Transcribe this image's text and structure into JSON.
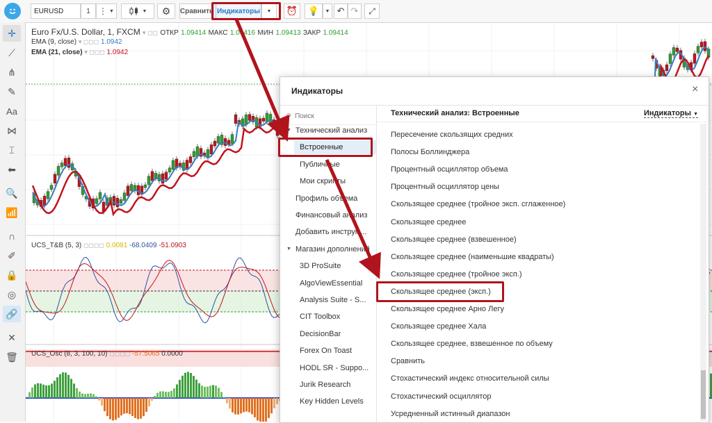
{
  "toolbar": {
    "symbol": "EURUSD",
    "interval": "1",
    "compare_label": "Сравнить",
    "indicators_label": "Индикаторы"
  },
  "legend": {
    "main": {
      "title": "Euro Fx/U.S. Dollar, 1, FXCM",
      "open_label": "ОТКР",
      "open": "1.09414",
      "high_label": "МАКС",
      "high": "1.09416",
      "low_label": "МИН",
      "low": "1.09413",
      "close_label": "ЗАКР",
      "close": "1.09414"
    },
    "ema9": {
      "label": "EMA (9, close)",
      "value": "1.0942",
      "color": "#3a7bbf"
    },
    "ema21": {
      "label": "EMA (21, close)",
      "value": "1.0942",
      "color": "#c0141c"
    },
    "ucs_tb": {
      "label": "UCS_T&B (5, 3)",
      "v1": "0.0081",
      "v1_color": "#d9b500",
      "v2": "-68.0409",
      "v2_color": "#3050a0",
      "v3": "-51.0903",
      "v3_color": "#c0141c"
    },
    "ucs_osc": {
      "label": "UCS_Osc (8, 3, 100, 10)",
      "v1": "-57.5065",
      "v1_color": "#e07020",
      "v2": "0.0000",
      "v2_color": "#333333"
    }
  },
  "dialog": {
    "title": "Индикаторы",
    "close": "×",
    "search_placeholder": "Поиск",
    "right_title": "Технический анализ: Встроенные",
    "dropdown_label": "Индикаторы",
    "left_items": [
      {
        "label": "Технический анализ",
        "kind": "group"
      },
      {
        "label": "Встроенные",
        "kind": "selected"
      },
      {
        "label": "Публичные",
        "kind": "sub"
      },
      {
        "label": "Мои скрипты",
        "kind": "sub"
      },
      {
        "label": "Профиль объема",
        "kind": "top"
      },
      {
        "label": "Финансовый анализ",
        "kind": "top"
      },
      {
        "label": "Добавить инструм...",
        "kind": "top"
      },
      {
        "label": "Магазин дополнений",
        "kind": "group"
      },
      {
        "label": "3D ProSuite",
        "kind": "sub"
      },
      {
        "label": "AlgoViewEssential",
        "kind": "sub"
      },
      {
        "label": "Analysis Suite - S...",
        "kind": "sub"
      },
      {
        "label": "CIT Toolbox",
        "kind": "sub"
      },
      {
        "label": "DecisionBar",
        "kind": "sub"
      },
      {
        "label": "Forex On Toast",
        "kind": "sub"
      },
      {
        "label": "HODL SR - Suppo...",
        "kind": "sub"
      },
      {
        "label": "Jurik Research",
        "kind": "sub"
      },
      {
        "label": "Key Hidden Levels",
        "kind": "sub"
      }
    ],
    "right_items": [
      "Пересечение скользящих средних",
      "Полосы Боллинджера",
      "Процентный осциллятор объема",
      "Процентный осциллятор цены",
      "Скользящее среднее (тройное эксп. сглаженное)",
      "Скользящее среднее",
      "Скользящее среднее (взвешенное)",
      "Скользящее среднее (наименьшие квадраты)",
      "Скользящее среднее (тройное эксп.)",
      "Скользящее среднее (эксп.)",
      "Скользящее среднее Арно Легу",
      "Скользящее среднее Хала",
      "Скользящее среднее, взвешенное по объему",
      "Сравнить",
      "Стохастический индекс относительной силы",
      "Стохастический осциллятор",
      "Усредненный истинный диапазон"
    ]
  },
  "colors": {
    "annotation": "#b0141c",
    "ema9": "#3a7bbf",
    "ema21": "#c0141c",
    "candle_up": "#2f9e2f",
    "candle_down": "#c0141c"
  }
}
